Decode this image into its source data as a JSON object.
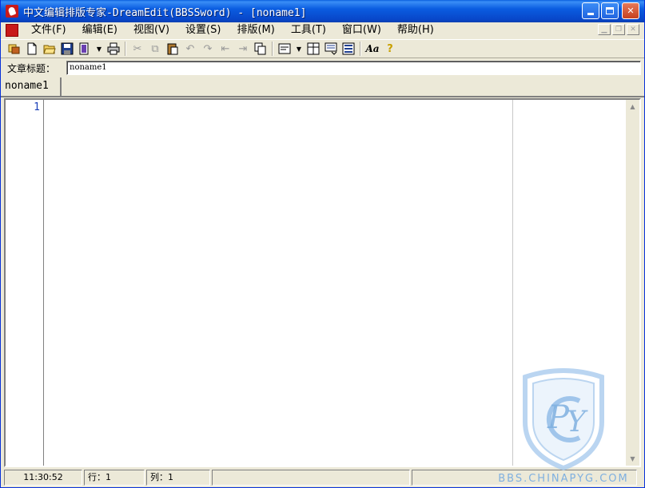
{
  "window": {
    "title": "中文编辑排版专家-DreamEdit(BBSSword) - [noname1]",
    "app_icon": "dreamedit-app-icon",
    "controls": {
      "minimize": "minimize-icon",
      "maximize": "maximize-icon",
      "close": "✕"
    }
  },
  "menu": {
    "items": [
      {
        "label": "文件(F)"
      },
      {
        "label": "编辑(E)"
      },
      {
        "label": "视图(V)"
      },
      {
        "label": "设置(S)"
      },
      {
        "label": "排版(M)"
      },
      {
        "label": "工具(T)"
      },
      {
        "label": "窗口(W)"
      },
      {
        "label": "帮助(H)"
      }
    ]
  },
  "toolbar": {
    "icons": [
      "open-multiple-icon",
      "new-file-icon",
      "open-folder-icon",
      "save-icon",
      "template-icon",
      "print-icon",
      "cut-icon",
      "copy-icon",
      "paste-icon",
      "undo-icon",
      "redo-icon",
      "indent-icon",
      "outdent-icon",
      "copy-all-icon",
      "format-icon",
      "layout-icon",
      "insert-icon",
      "columns-icon",
      "font-icon",
      "help-icon"
    ]
  },
  "article": {
    "label": "文章标题：",
    "value": "noname1"
  },
  "tabs": [
    {
      "label": "noname1"
    }
  ],
  "editor": {
    "line_numbers": [
      "1"
    ]
  },
  "status": {
    "time": "11:30:52",
    "row": "行：1",
    "col": "列：1"
  },
  "watermark": {
    "text": "BBS.CHINAPYG.COM",
    "logo_letters": "PY"
  },
  "colors": {
    "titlebar": "#0a5ce0",
    "line_number": "#1a3fb8",
    "watermark": "#7fb0e0"
  }
}
